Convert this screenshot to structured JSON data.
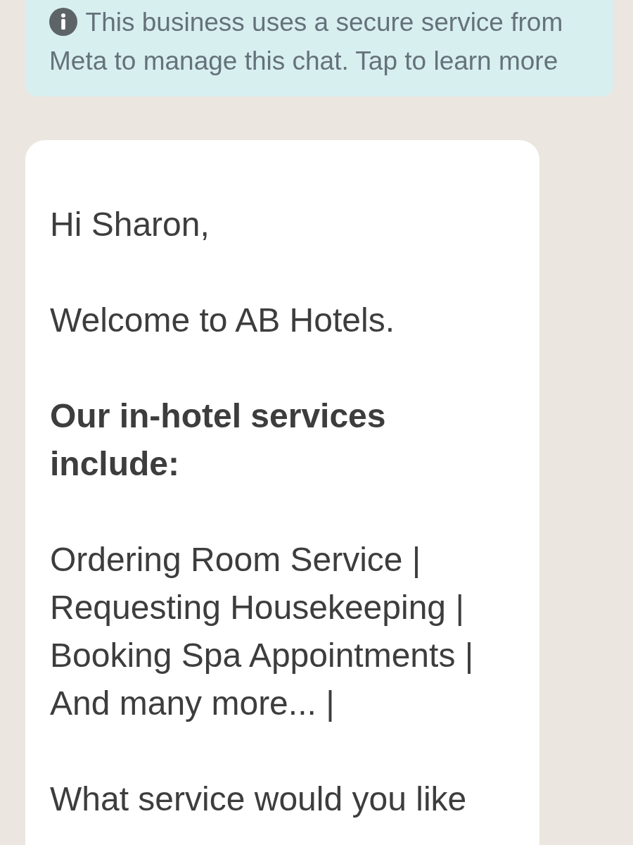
{
  "notice": {
    "text": "This business uses a secure service from Meta to manage this chat. Tap to learn more"
  },
  "message": {
    "paragraphs": [
      {
        "text": "Hi Sharon,",
        "bold": false
      },
      {
        "text": "Welcome to AB Hotels.",
        "bold": false
      },
      {
        "text": "Our in-hotel services include:",
        "bold": true
      },
      {
        "text": "Ordering Room Service | Requesting Housekeeping | Booking Spa Appointments | And many more... |",
        "bold": false
      },
      {
        "text": "What service would you like",
        "bold": false
      }
    ]
  }
}
